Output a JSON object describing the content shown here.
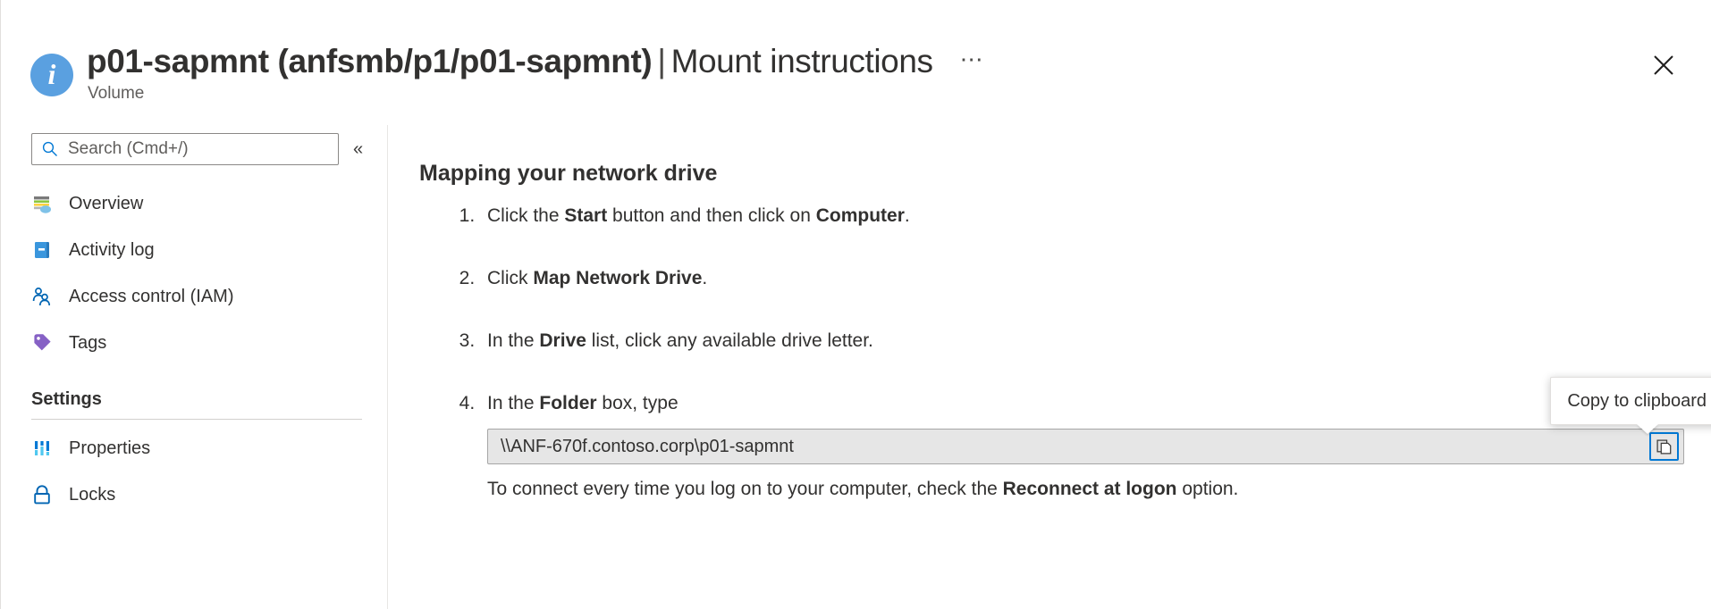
{
  "header": {
    "icon": "info-circle-icon",
    "title_resource": "p01-sapmnt (anfsmb/p1/p01-sapmnt)",
    "title_divider": "|",
    "title_section": "Mount instructions",
    "subtitle": "Volume",
    "more_label": "⋯",
    "close_label": "✕"
  },
  "sidebar": {
    "search": {
      "placeholder": "Search (Cmd+/)",
      "value": "",
      "icon": "search-icon"
    },
    "collapse_label": "«",
    "items": [
      {
        "label": "Overview",
        "icon": "overview-icon"
      },
      {
        "label": "Activity log",
        "icon": "activity-log-icon"
      },
      {
        "label": "Access control (IAM)",
        "icon": "access-control-icon"
      },
      {
        "label": "Tags",
        "icon": "tags-icon"
      }
    ],
    "group_header": "Settings",
    "settings_items": [
      {
        "label": "Properties",
        "icon": "properties-icon"
      },
      {
        "label": "Locks",
        "icon": "locks-icon"
      }
    ]
  },
  "main": {
    "section_title": "Mapping your network drive",
    "steps": [
      {
        "parts": [
          {
            "t": "Click the ",
            "b": false
          },
          {
            "t": "Start",
            "b": true
          },
          {
            "t": " button and then click on ",
            "b": false
          },
          {
            "t": "Computer",
            "b": true
          },
          {
            "t": ".",
            "b": false
          }
        ]
      },
      {
        "parts": [
          {
            "t": "Click ",
            "b": false
          },
          {
            "t": "Map Network Drive",
            "b": true
          },
          {
            "t": ".",
            "b": false
          }
        ]
      },
      {
        "parts": [
          {
            "t": "In the ",
            "b": false
          },
          {
            "t": "Drive",
            "b": true
          },
          {
            "t": " list, click any available drive letter.",
            "b": false
          }
        ]
      },
      {
        "parts": [
          {
            "t": "In the ",
            "b": false
          },
          {
            "t": "Folder",
            "b": true
          },
          {
            "t": " box, type",
            "b": false
          }
        ]
      }
    ],
    "mount_path": "\\\\ANF-670f.contoso.corp\\p01-sapmnt",
    "copy_tooltip": "Copy to clipboard",
    "copy_icon": "copy-icon",
    "reconnect_parts": [
      {
        "t": "To connect every time you log on to your computer, check the ",
        "b": false
      },
      {
        "t": "Reconnect at logon",
        "b": true
      },
      {
        "t": " option.",
        "b": false
      }
    ]
  },
  "colors": {
    "accent": "#0078d4",
    "info_blue": "#5aa0e0",
    "tag_purple": "#8661c5",
    "text": "#323130"
  }
}
